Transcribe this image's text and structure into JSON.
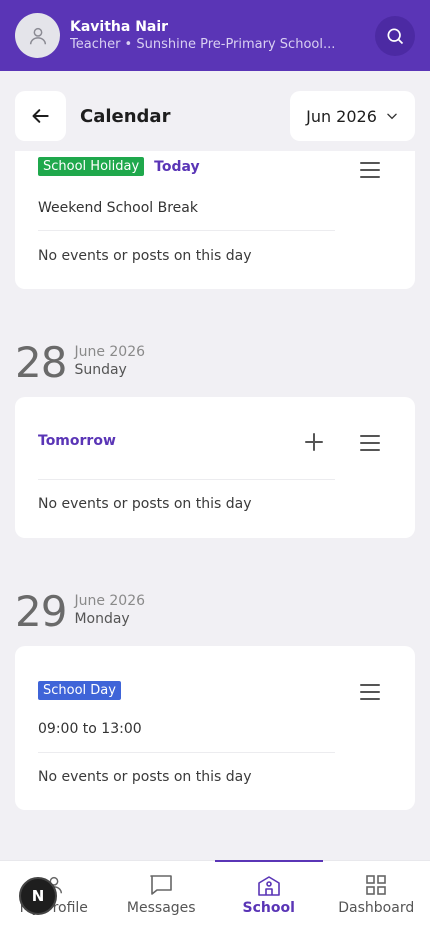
{
  "app_bar": {
    "user_name": "Kavitha Nair",
    "user_role": "Teacher • Sunshine Pre-Primary School...",
    "bg_color": "#5a35b6"
  },
  "header": {
    "title": "Calendar",
    "month_select": "Jun 2026"
  },
  "days": [
    {
      "badge": "School Holiday",
      "today_label": "Today",
      "event_title": "Weekend School Break",
      "empty_text": "No events or posts on this day"
    },
    {
      "date_num": "28",
      "date_month": "June 2026",
      "date_weekday": "Sunday",
      "label": "Tomorrow",
      "empty_text": "No events or posts on this day"
    },
    {
      "date_num": "29",
      "date_month": "June 2026",
      "date_weekday": "Monday",
      "badge": "School Day",
      "time": "09:00 to 13:00",
      "empty_text": "No events or posts on this day"
    }
  ],
  "bottom_nav": {
    "items": [
      {
        "label": "My Profile",
        "icon": "person-icon"
      },
      {
        "label": "Messages",
        "icon": "chat-icon"
      },
      {
        "label": "School",
        "icon": "school-icon",
        "active": true
      },
      {
        "label": "Dashboard",
        "icon": "grid-icon"
      }
    ],
    "fab_letter": "N"
  }
}
